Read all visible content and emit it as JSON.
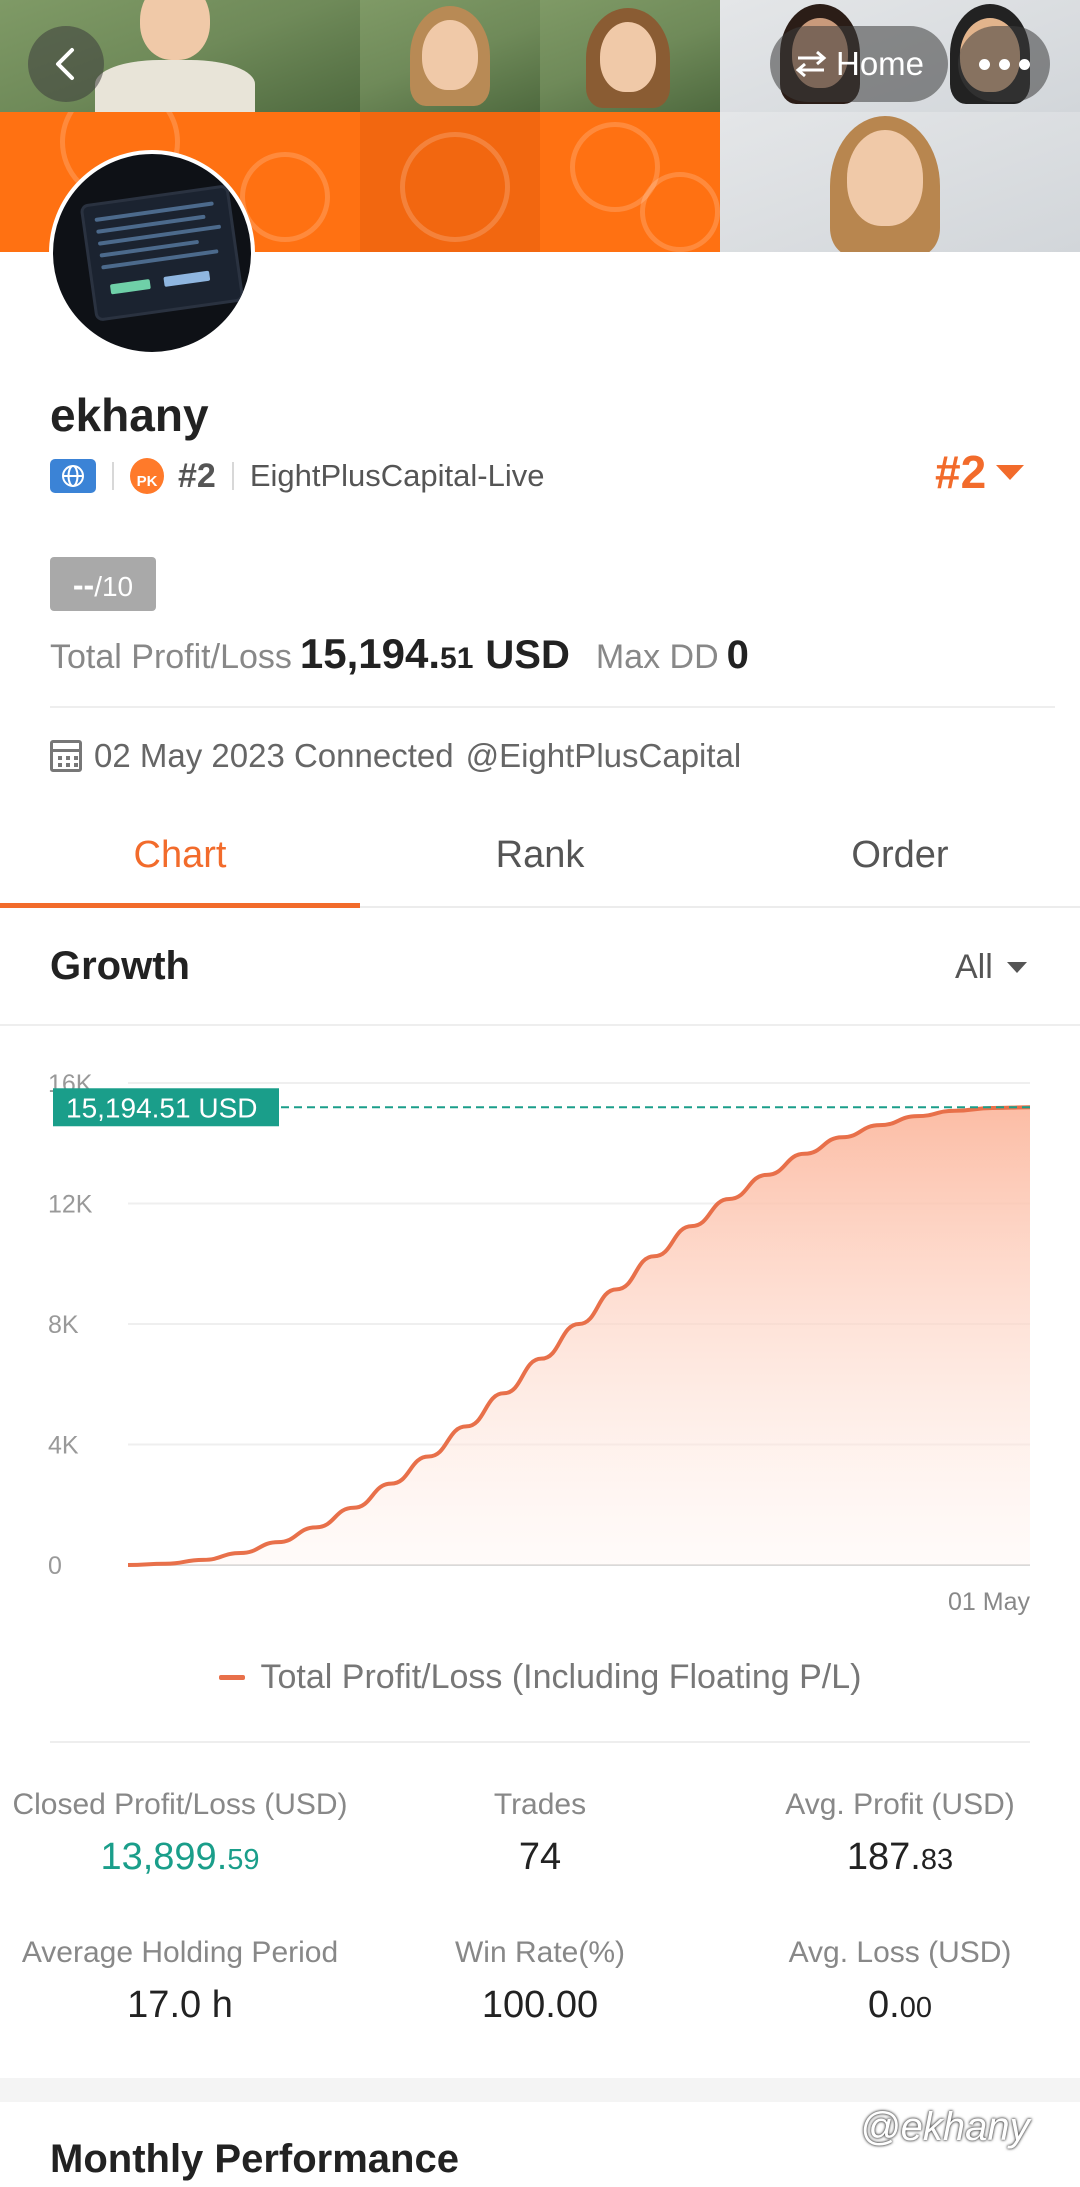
{
  "header": {
    "home_label": "Home",
    "back_icon": "chevron-left-icon",
    "more_icon": "ellipsis-icon",
    "swap_icon": "swap-arrows-icon"
  },
  "profile": {
    "username": "ekhany",
    "rank_small": "#2",
    "pk_badge": "PK",
    "server": "EightPlusCapital-Live",
    "rank_big": "#2",
    "score_dash": "--",
    "score_den": "/10",
    "total_pl_label": "Total Profit/Loss",
    "total_pl_int": "15,194.",
    "total_pl_dec": "51",
    "total_pl_currency": "USD",
    "max_dd_label": "Max DD",
    "max_dd_value": "0",
    "connected_text": "02 May 2023 Connected",
    "connected_handle": "@EightPlusCapital"
  },
  "tabs": [
    {
      "label": "Chart",
      "active": true
    },
    {
      "label": "Rank",
      "active": false
    },
    {
      "label": "Order",
      "active": false
    }
  ],
  "growth": {
    "title": "Growth",
    "filter": "All"
  },
  "chart_data": {
    "type": "area",
    "ylim": [
      0,
      16000
    ],
    "yticks": [
      "0",
      "4K",
      "8K",
      "12K",
      "16K"
    ],
    "ytick_values": [
      0,
      4000,
      8000,
      12000,
      16000
    ],
    "xtick_label": "01 May",
    "current_value_label": "15,194.51 USD",
    "current_value": 15194.51,
    "series": [
      {
        "name": "Total Profit/Loss (Including Floating P/L)",
        "values": [
          0,
          40,
          170,
          400,
          760,
          1250,
          1900,
          2700,
          3600,
          4600,
          5700,
          6850,
          8000,
          9150,
          10250,
          11250,
          12150,
          12950,
          13650,
          14200,
          14600,
          14900,
          15080,
          15170,
          15194.51
        ]
      }
    ],
    "colors": {
      "line": "#e8704a",
      "fill_top": "#fcb9a0",
      "current": "#1a9e8a"
    }
  },
  "stats": {
    "closed_pl_label": "Closed Profit/Loss (USD)",
    "closed_pl_int": "13,899.",
    "closed_pl_dec": "59",
    "trades_label": "Trades",
    "trades_value": "74",
    "avg_profit_label": "Avg. Profit (USD)",
    "avg_profit_int": "187.",
    "avg_profit_dec": "83",
    "holding_label": "Average Holding Period",
    "holding_value": "17.0 h",
    "win_rate_label": "Win Rate(%)",
    "win_rate_value": "100.00",
    "avg_loss_label": "Avg. Loss (USD)",
    "avg_loss_int": "0.",
    "avg_loss_dec": "00"
  },
  "monthly": {
    "title": "Monthly Performance"
  },
  "watermark": "@ekhany"
}
